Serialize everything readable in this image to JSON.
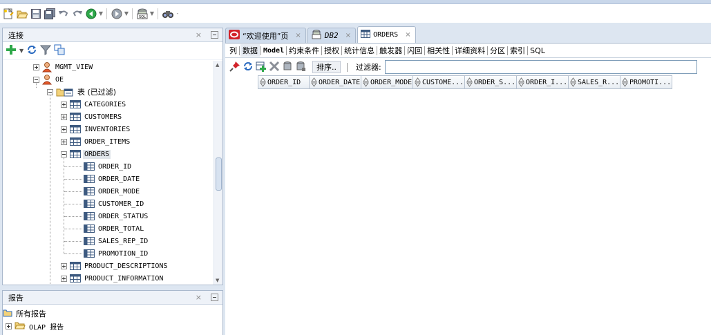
{
  "toolbar": {
    "icons": [
      "new-icon",
      "open-icon",
      "save-icon",
      "save-all-icon",
      "undo-icon",
      "redo-icon",
      "back-icon",
      "forward-icon",
      "sql-worksheet-icon",
      "find-icon"
    ]
  },
  "connections_panel": {
    "title": "连接",
    "tree": [
      {
        "label": "MGMT_VIEW"
      },
      {
        "label": "OE"
      },
      {
        "label": "表 (已过滤)"
      },
      {
        "label": "CATEGORIES"
      },
      {
        "label": "CUSTOMERS"
      },
      {
        "label": "INVENTORIES"
      },
      {
        "label": "ORDER_ITEMS"
      },
      {
        "label": "ORDERS"
      },
      {
        "label": "ORDER_ID"
      },
      {
        "label": "ORDER_DATE"
      },
      {
        "label": "ORDER_MODE"
      },
      {
        "label": "CUSTOMER_ID"
      },
      {
        "label": "ORDER_STATUS"
      },
      {
        "label": "ORDER_TOTAL"
      },
      {
        "label": "SALES_REP_ID"
      },
      {
        "label": "PROMOTION_ID"
      },
      {
        "label": "PRODUCT_DESCRIPTIONS"
      },
      {
        "label": "PRODUCT_INFORMATION"
      }
    ]
  },
  "reports_panel": {
    "title": "报告",
    "items": [
      {
        "label": "所有报告"
      },
      {
        "label": "OLAP 报告"
      }
    ]
  },
  "editor_tabs": [
    {
      "label": "“欢迎使用”页"
    },
    {
      "label": "DB2"
    },
    {
      "label": "ORDERS"
    }
  ],
  "subtabs": [
    "列",
    "数据",
    "Model",
    "约束条件",
    "授权",
    "统计信息",
    "触发器",
    "闪回",
    "相关性",
    "详细资料",
    "分区",
    "索引",
    "SQL"
  ],
  "data_toolbar": {
    "sort_label": "排序..",
    "filter_label": "过滤器:",
    "filter_value": ""
  },
  "grid": {
    "columns": [
      "ORDER_ID",
      "ORDER_DATE",
      "ORDER_MODE",
      "CUSTOME...",
      "ORDER_S...",
      "ORDER_I...",
      "SALES_R...",
      "PROMOTI..."
    ]
  },
  "colors": {
    "chrome_bg": "#dde6f1",
    "tab_inactive": "#cfdcec",
    "oracle_red": "#d2232a"
  }
}
